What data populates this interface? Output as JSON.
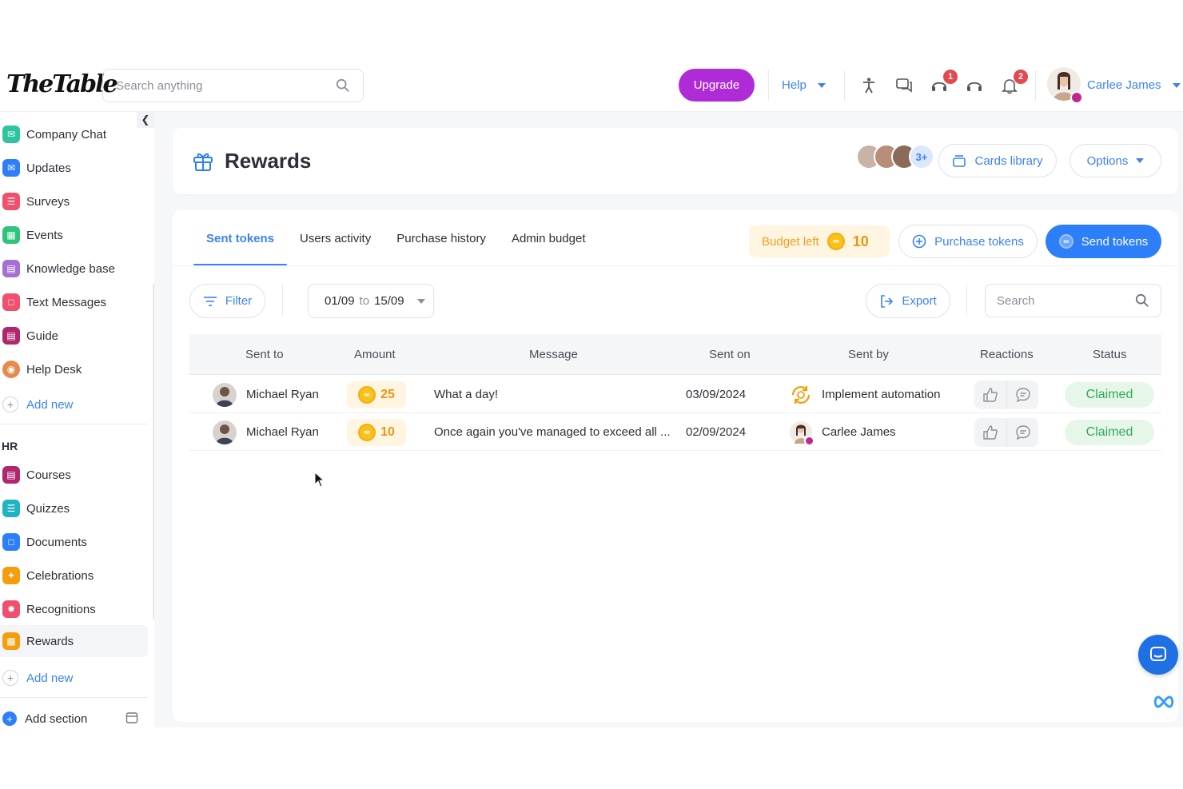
{
  "app": {
    "logo_text": "TheTable"
  },
  "topbar": {
    "search_placeholder": "Search anything",
    "upgrade_label": "Upgrade",
    "help_label": "Help",
    "chat_badge": "1",
    "notifications_badge": "2",
    "user_name": "Carlee James"
  },
  "sidebar": {
    "items": [
      {
        "label": "Company Chat",
        "color": "#2ec4a0"
      },
      {
        "label": "Updates",
        "color": "#2d7ff9"
      },
      {
        "label": "Surveys",
        "color": "#f0506e"
      },
      {
        "label": "Events",
        "color": "#2ec47a"
      },
      {
        "label": "Knowledge base",
        "color": "#a66fd6"
      },
      {
        "label": "Text Messages",
        "color": "#f0506e"
      },
      {
        "label": "Guide",
        "color": "#b0276e"
      },
      {
        "label": "Help Desk",
        "color": "#e58a4e"
      }
    ],
    "add_new_label": "Add new",
    "hr_heading": "HR",
    "hr_items": [
      {
        "label": "Courses",
        "color": "#b0276e"
      },
      {
        "label": "Quizzes",
        "color": "#1fb3c4"
      },
      {
        "label": "Documents",
        "color": "#2d7ff9"
      },
      {
        "label": "Celebrations",
        "color": "#f59e0b"
      },
      {
        "label": "Recognitions",
        "color": "#f0506e"
      },
      {
        "label": "Rewards",
        "color": "#f59e0b"
      }
    ],
    "hr_add_new_label": "Add new",
    "add_section_label": "Add section"
  },
  "header": {
    "title": "Rewards",
    "more_avatars": "3+",
    "cards_library_label": "Cards library",
    "options_label": "Options"
  },
  "tabs": [
    {
      "label": "Sent tokens",
      "active": true
    },
    {
      "label": "Users activity",
      "active": false
    },
    {
      "label": "Purchase history",
      "active": false
    },
    {
      "label": "Admin budget",
      "active": false
    }
  ],
  "budget": {
    "label": "Budget left",
    "value": "10"
  },
  "purchase_tokens_label": "Purchase tokens",
  "send_tokens_label": "Send tokens",
  "filters": {
    "filter_label": "Filter",
    "date_from": "01/09",
    "date_to_word": "to",
    "date_to": "15/09",
    "export_label": "Export",
    "search_placeholder": "Search"
  },
  "table": {
    "columns": [
      "Sent to",
      "Amount",
      "Message",
      "Sent on",
      "Sent by",
      "Reactions",
      "Status"
    ],
    "rows": [
      {
        "sent_to": "Michael Ryan",
        "amount": "25",
        "message": "What a day!",
        "sent_on": "03/09/2024",
        "sent_by": "Implement automation",
        "status": "Claimed"
      },
      {
        "sent_to": "Michael Ryan",
        "amount": "10",
        "message": "Once again you've managed to exceed all ...",
        "sent_on": "02/09/2024",
        "sent_by": "Carlee James",
        "status": "Claimed"
      }
    ]
  }
}
